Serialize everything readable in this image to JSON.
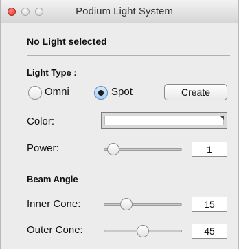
{
  "window": {
    "title": "Podium Light System"
  },
  "status": {
    "selection": "No Light selected"
  },
  "light_type": {
    "heading": "Light Type :",
    "options": [
      {
        "label": "Omni",
        "selected": false
      },
      {
        "label": "Spot",
        "selected": true
      }
    ],
    "create_label": "Create"
  },
  "color": {
    "label": "Color:",
    "value": "#ffffff"
  },
  "power": {
    "label": "Power:",
    "value": "1",
    "slider_fraction": 0.05
  },
  "beam_angle": {
    "heading": "Beam Angle",
    "inner": {
      "label": "Inner Cone:",
      "value": "15",
      "slider_fraction": 0.25
    },
    "outer": {
      "label": "Outer Cone:",
      "value": "45",
      "slider_fraction": 0.5
    }
  }
}
